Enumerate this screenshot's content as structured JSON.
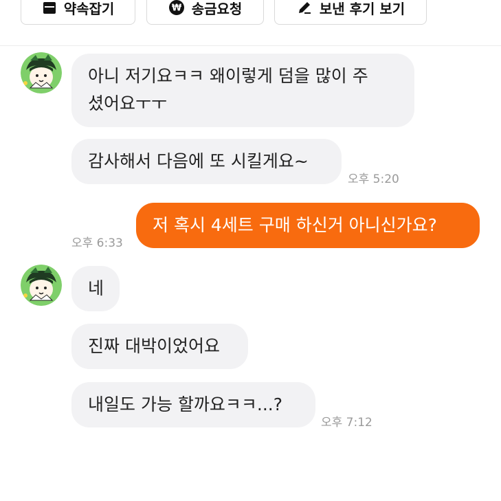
{
  "toolbar": {
    "buttons": [
      {
        "label": "약속잡기",
        "icon": "calendar-icon"
      },
      {
        "label": "송금요청",
        "icon": "won-icon"
      },
      {
        "label": "보낸 후기 보기",
        "icon": "pencil-icon"
      }
    ]
  },
  "messages": {
    "m1_line1": "아니 저기요ㅋㅋ 왜이렇게 덤을 많이 주",
    "m1_line2": "셨어요ㅜㅜ",
    "m2": "감사해서 다음에 또 시킬게요~",
    "m2_time": "오후 5:20",
    "m3": "저 혹시 4세트 구매 하신거 아니신가요?",
    "m3_time": "오후 6:33",
    "m4": "네",
    "m5": "진짜 대박이었어요",
    "m6": "내일도 가능 할까요ㅋㅋ...?",
    "m6_time": "오후 7:12"
  },
  "colors": {
    "accent": "#f86b0f",
    "incoming_bubble": "#f2f2f4",
    "timestamp": "#9a9a9a"
  }
}
